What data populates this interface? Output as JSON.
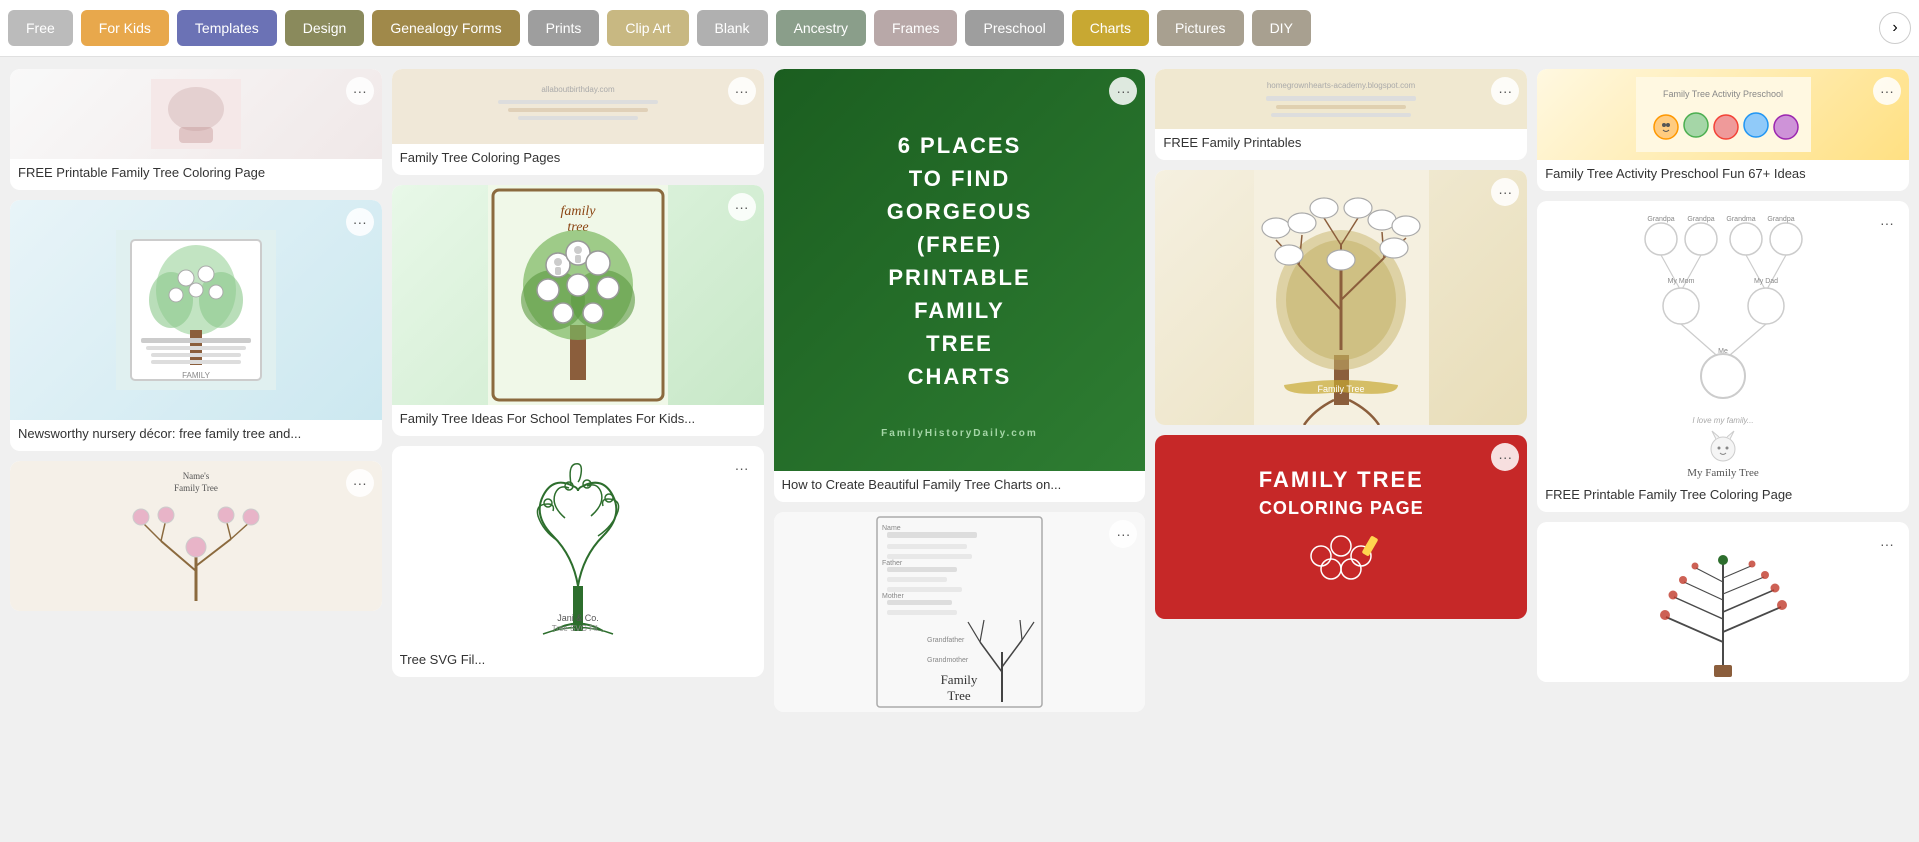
{
  "nav": {
    "buttons": [
      {
        "label": "Free",
        "style": "gray",
        "id": "free"
      },
      {
        "label": "For Kids",
        "style": "orange",
        "id": "for-kids"
      },
      {
        "label": "Templates",
        "style": "purple",
        "id": "templates"
      },
      {
        "label": "Design",
        "style": "olive",
        "id": "design"
      },
      {
        "label": "Genealogy Forms",
        "style": "brown",
        "id": "genealogy-forms"
      },
      {
        "label": "Prints",
        "style": "mid-gray",
        "id": "prints"
      },
      {
        "label": "Clip Art",
        "style": "tan",
        "id": "clip-art"
      },
      {
        "label": "Blank",
        "style": "light-gray",
        "id": "blank"
      },
      {
        "label": "Ancestry",
        "style": "sage",
        "id": "ancestry"
      },
      {
        "label": "Frames",
        "style": "pink-gray",
        "id": "frames"
      },
      {
        "label": "Preschool",
        "style": "mid-gray",
        "id": "preschool"
      },
      {
        "label": "Charts",
        "style": "golden",
        "id": "charts"
      },
      {
        "label": "Pictures",
        "style": "stone",
        "id": "pictures"
      },
      {
        "label": "DIY",
        "style": "stone",
        "id": "diy"
      }
    ],
    "arrow_next": "›"
  },
  "cards": {
    "col1": [
      {
        "id": "free-printable-coloring",
        "caption": "FREE Printable Family Tree Coloring Page",
        "img_type": "pink-coloring"
      },
      {
        "id": "free-printable-hallmark",
        "caption": "Newsworthy nursery décor: free family tree and...",
        "img_type": "free-printable"
      },
      {
        "id": "names-family-tree",
        "caption": "",
        "img_type": "names-tree"
      }
    ],
    "col2": [
      {
        "id": "family-tree-coloring-pages",
        "caption": "Family Tree Coloring Pages",
        "img_type": "coloring-pages-banner"
      },
      {
        "id": "family-tree-school-templates",
        "caption": "Family Tree Ideas For School Templates For Kids...",
        "img_type": "school-template"
      },
      {
        "id": "tree-svg-file",
        "caption": "Tree SVG Fil...",
        "img_type": "svg-tree"
      }
    ],
    "col3": [
      {
        "id": "6-places-gorgeous",
        "caption": "How to Create Beautiful Family Tree Charts on...",
        "img_type": "green-text"
      },
      {
        "id": "family-tree-form-blank",
        "caption": "",
        "img_type": "form-blank"
      }
    ],
    "col4": [
      {
        "id": "free-family-printables",
        "caption": "FREE Family Printables",
        "img_type": "free-printables-banner"
      },
      {
        "id": "beige-tree",
        "caption": "",
        "img_type": "beige-tree"
      },
      {
        "id": "family-tree-coloring-page-red",
        "caption": "",
        "img_type": "red-coloring"
      }
    ],
    "col5": [
      {
        "id": "family-tree-activity-preschool",
        "caption": "Family Tree Activity Preschool Fun 67+ Ideas",
        "img_type": "preschool"
      },
      {
        "id": "free-printable-coloring-2",
        "caption": "FREE Printable Family Tree Coloring Page",
        "img_type": "white-sketch"
      },
      {
        "id": "spiral-tree",
        "caption": "",
        "img_type": "spiral-tree"
      }
    ]
  },
  "menu_icon": "···",
  "green_text_lines": [
    "6 PLACES",
    "TO FIND",
    "GORGEOUS",
    "(FREE)",
    "PRINTABLE",
    "FAMILY",
    "TREE",
    "CHARTS"
  ],
  "red_text_lines": [
    "FAMILY TREE",
    "COLORING PAGE"
  ],
  "site_credit": "FamilyHistoryDaily.com",
  "family_tree_label": "FAMILY TREE"
}
